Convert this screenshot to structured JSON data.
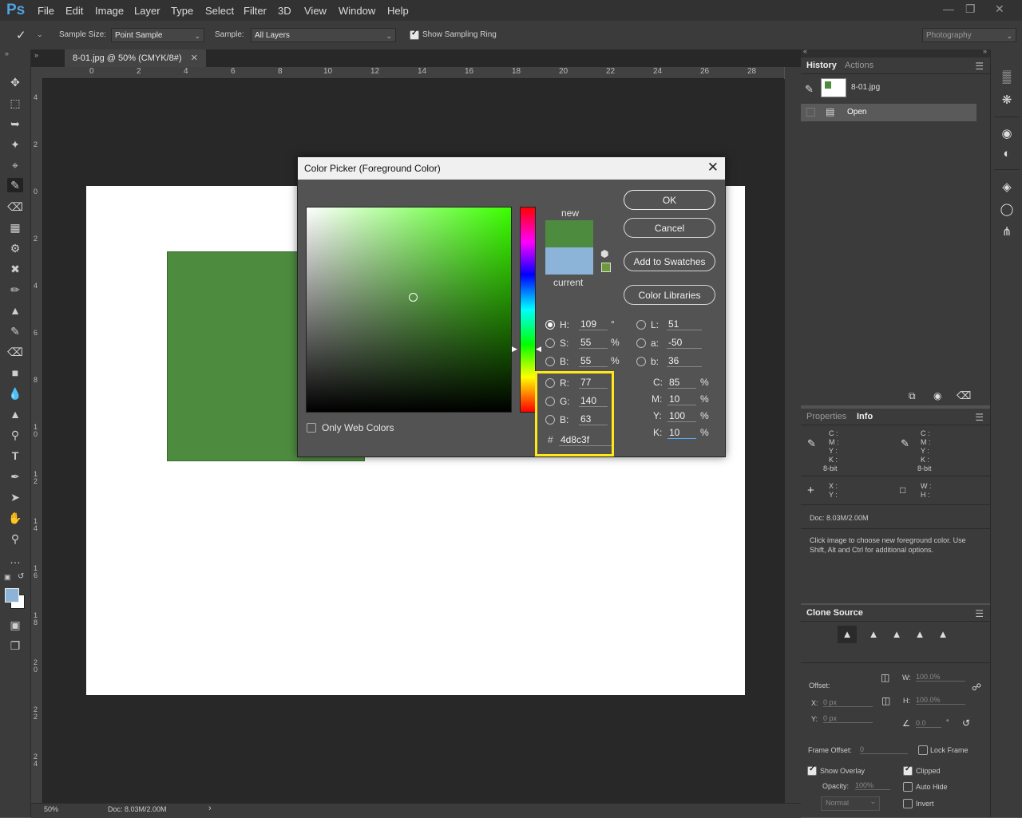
{
  "app": {
    "logo": "Ps"
  },
  "menu": [
    "File",
    "Edit",
    "Image",
    "Layer",
    "Type",
    "Select",
    "Filter",
    "3D",
    "View",
    "Window",
    "Help"
  ],
  "options": {
    "sample_size_label": "Sample Size:",
    "sample_size_value": "Point Sample",
    "sample_label": "Sample:",
    "sample_value": "All Layers",
    "show_ring_label": "Show Sampling Ring",
    "workspace": "Photography"
  },
  "document": {
    "tab_title": "8-01.jpg @ 50% (CMYK/8#)",
    "ruler_top": [
      "0",
      "2",
      "4",
      "6",
      "8",
      "10",
      "12",
      "14",
      "16",
      "18",
      "20",
      "22",
      "24",
      "26",
      "28"
    ],
    "ruler_left": [
      "4",
      "2",
      "0",
      "2",
      "4",
      "6",
      "8",
      "1 0",
      "1 2",
      "1 4",
      "1 6",
      "1 8",
      "2 0",
      "2 2",
      "2 4"
    ],
    "zoom": "50%",
    "doc_size": "Doc: 8.03M/2.00M",
    "shape_color": "#4d8c3f"
  },
  "dialog": {
    "title": "Color Picker (Foreground Color)",
    "buttons": {
      "ok": "OK",
      "cancel": "Cancel",
      "add_swatches": "Add to Swatches",
      "color_libraries": "Color Libraries"
    },
    "new_label": "new",
    "current_label": "current",
    "new_color": "#4d8c3f",
    "current_color": "#8cb4d9",
    "only_web_colors": "Only Web Colors",
    "hsb": {
      "h_label": "H:",
      "h": "109",
      "h_unit": "°",
      "s_label": "S:",
      "s": "55",
      "s_unit": "%",
      "b_label": "B:",
      "b": "55",
      "b_unit": "%"
    },
    "lab": {
      "l_label": "L:",
      "l": "51",
      "a_label": "a:",
      "a": "-50",
      "b_label": "b:",
      "b": "36"
    },
    "rgb": {
      "r_label": "R:",
      "r": "77",
      "g_label": "G:",
      "g": "140",
      "b_label": "B:",
      "b": "63"
    },
    "cmyk": {
      "c_label": "C:",
      "c": "85",
      "m_label": "M:",
      "m": "10",
      "y_label": "Y:",
      "y": "100",
      "k_label": "K:",
      "k": "10",
      "unit": "%"
    },
    "hex_label": "#",
    "hex": "4d8c3f"
  },
  "history": {
    "tabs": [
      "History",
      "Actions"
    ],
    "snapshot": "8-01.jpg",
    "steps": [
      "Open"
    ]
  },
  "info": {
    "tabs": [
      "Properties",
      "Info"
    ],
    "cmyk_letters": [
      "C :",
      "M :",
      "Y :",
      "K :"
    ],
    "bit_depth": "8-bit",
    "xy_letters": [
      "X :",
      "Y :"
    ],
    "wh_letters": [
      "W :",
      "H :"
    ],
    "doc": "Doc: 8.03M/2.00M",
    "hint": "Click image to choose new foreground color. Use Shift, Alt and Ctrl for additional options."
  },
  "clone": {
    "title": "Clone Source",
    "offset_label": "Offset:",
    "x_label": "X:",
    "x_value": "0 px",
    "y_label": "Y:",
    "y_value": "0 px",
    "w_label": "W:",
    "w_value": "100.0%",
    "h_label": "H:",
    "h_value": "100.0%",
    "angle_value": "0.0",
    "angle_unit": "°",
    "frame_offset_label": "Frame Offset:",
    "frame_offset_value": "0",
    "lock_frame": "Lock Frame",
    "show_overlay": "Show Overlay",
    "clipped": "Clipped",
    "opacity_label": "Opacity:",
    "opacity_value": "100%",
    "auto_hide": "Auto Hide",
    "blend_mode": "Normal",
    "invert": "Invert"
  }
}
